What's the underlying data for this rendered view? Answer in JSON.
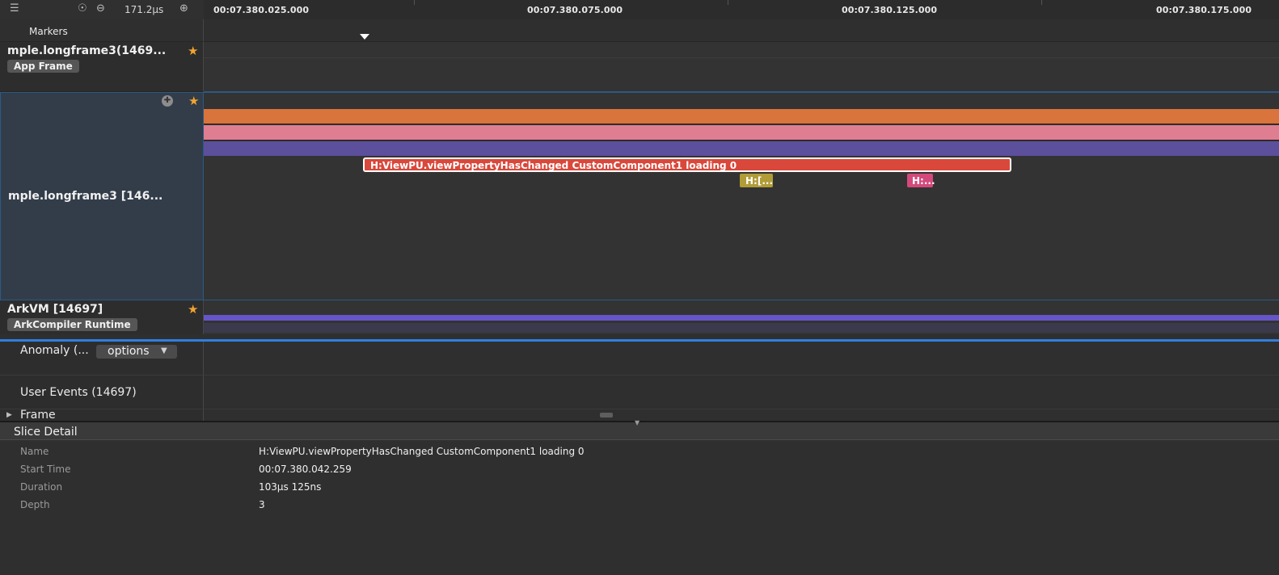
{
  "toolbar": {
    "menu_icon": "menu-icon",
    "reset_icon": "reset-zoom-icon",
    "zoom_out_icon": "zoom-out-icon",
    "zoom_level": "171.2µs",
    "zoom_in_icon": "zoom-in-icon"
  },
  "ruler": {
    "ticks": [
      "00:07.380.025.000",
      "00:07.380.075.000",
      "00:07.380.125.000",
      "00:07.380.175.000"
    ]
  },
  "markers": {
    "label": "Markers"
  },
  "tracks": [
    {
      "title": "mple.longframe3(1469...",
      "tag": "App Frame"
    },
    {
      "title": "mple.longframe3 [146..."
    },
    {
      "title": "ArkVM [14697]",
      "tag": "ArkCompiler Runtime"
    },
    {
      "title": "Anomaly (...",
      "dropdown": "options"
    },
    {
      "title": "User Events (14697)"
    },
    {
      "title": "Frame"
    }
  ],
  "slices": {
    "main": "H:ViewPU.viewPropertyHasChanged CustomComponent1 loading 0",
    "small_a": "H:[...",
    "small_b": "H:..."
  },
  "colors": {
    "lane1": "#d9743c",
    "lane2": "#e07e91",
    "lane3": "#5c4f9c",
    "selected_slice": "#d9483b",
    "small_a": "#b19c37",
    "small_b": "#d4497c",
    "accent": "#2f7fe0",
    "star": "#f2a431"
  },
  "detail": {
    "title": "Slice Detail",
    "rows": [
      {
        "key": "Name",
        "value": "H:ViewPU.viewPropertyHasChanged CustomComponent1 loading 0"
      },
      {
        "key": "Start Time",
        "value": "00:07.380.042.259"
      },
      {
        "key": "Duration",
        "value": "103µs 125ns"
      },
      {
        "key": "Depth",
        "value": "3"
      }
    ]
  }
}
